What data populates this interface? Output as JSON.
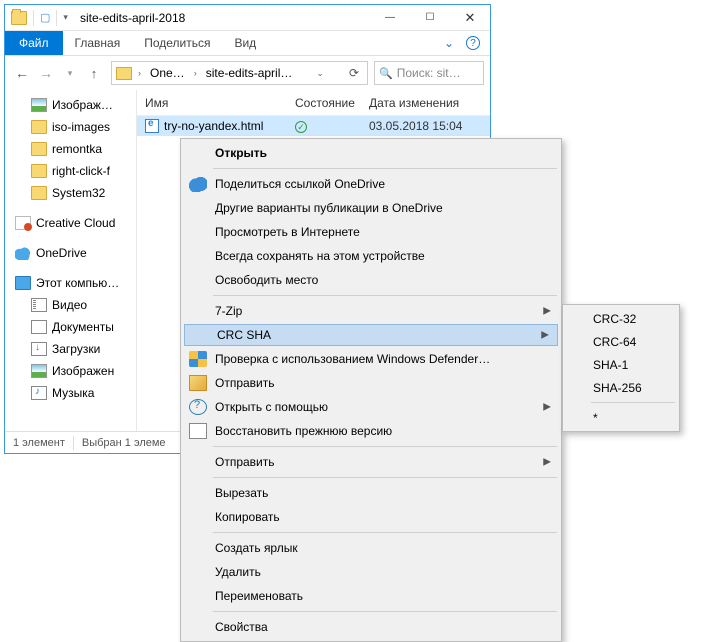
{
  "window": {
    "title": "site-edits-april-2018",
    "ribbon": {
      "file": "Файл",
      "tabs": [
        "Главная",
        "Поделиться",
        "Вид"
      ]
    },
    "address": {
      "crumb1": "One…",
      "crumb2": "site-edits-april…"
    },
    "search_placeholder": "Поиск: sit…",
    "columns": {
      "name": "Имя",
      "state": "Состояние",
      "date": "Дата изменения"
    },
    "file": {
      "name": "try-no-yandex.html",
      "state_glyph": "✓",
      "date": "03.05.2018 15:04"
    },
    "status": {
      "count": "1 элемент",
      "selection": "Выбран 1 элеме"
    }
  },
  "sidebar": {
    "images": "Изображ…",
    "iso": "iso-images",
    "remontka": "remontka",
    "rightclick": "right-click-f",
    "system32": "System32",
    "creativecloud": "Creative Cloud",
    "onedrive": "OneDrive",
    "thispc": "Этот компью…",
    "video": "Видео",
    "documents": "Документы",
    "downloads": "Загрузки",
    "images2": "Изображен",
    "music": "Музыка"
  },
  "context_menu": {
    "open": "Открыть",
    "share_onedrive": "Поделиться ссылкой OneDrive",
    "other_publish": "Другие варианты публикации в OneDrive",
    "view_internet": "Просмотреть в Интернете",
    "always_keep": "Всегда сохранять на этом устройстве",
    "free_space": "Освободить место",
    "seven_zip": "7-Zip",
    "crc_sha": "CRC SHA",
    "defender": "Проверка с использованием Windows Defender…",
    "send": "Отправить",
    "open_with": "Открыть с помощью",
    "restore": "Восстановить прежнюю версию",
    "send_to": "Отправить",
    "cut": "Вырезать",
    "copy": "Копировать",
    "shortcut": "Создать ярлык",
    "delete": "Удалить",
    "rename": "Переименовать",
    "properties": "Свойства"
  },
  "submenu": {
    "crc32": "CRC-32",
    "crc64": "CRC-64",
    "sha1": "SHA-1",
    "sha256": "SHA-256",
    "star": "*"
  }
}
